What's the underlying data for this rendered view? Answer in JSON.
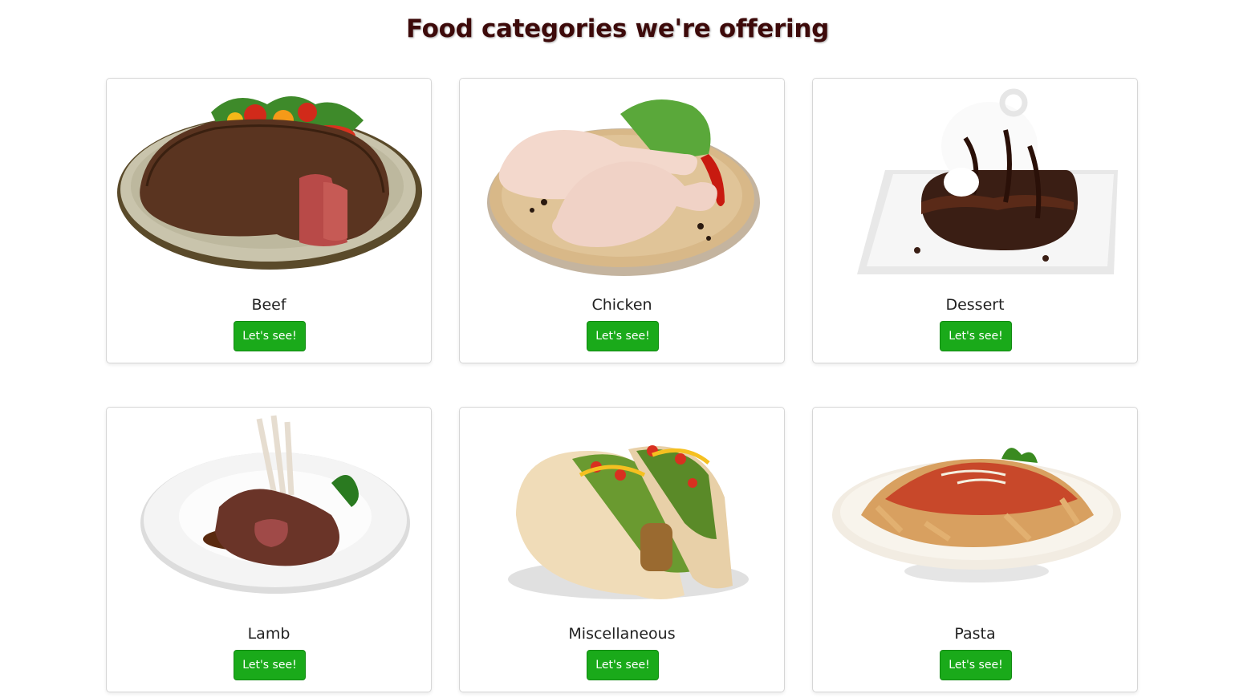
{
  "page": {
    "title": "Food categories we're offering"
  },
  "categories": [
    {
      "name": "Beef",
      "button_label": "Let's see!",
      "image_icon": "beef-steak-image"
    },
    {
      "name": "Chicken",
      "button_label": "Let's see!",
      "image_icon": "chicken-legs-image"
    },
    {
      "name": "Dessert",
      "button_label": "Let's see!",
      "image_icon": "chocolate-dessert-image"
    },
    {
      "name": "Lamb",
      "button_label": "Let's see!",
      "image_icon": "lamb-chops-image"
    },
    {
      "name": "Miscellaneous",
      "button_label": "Let's see!",
      "image_icon": "tacos-image"
    },
    {
      "name": "Pasta",
      "button_label": "Let's see!",
      "image_icon": "pasta-bowl-image"
    }
  ],
  "colors": {
    "title": "#3d0a0a",
    "button": "#1aaa1a",
    "button_text": "#ffffff"
  }
}
